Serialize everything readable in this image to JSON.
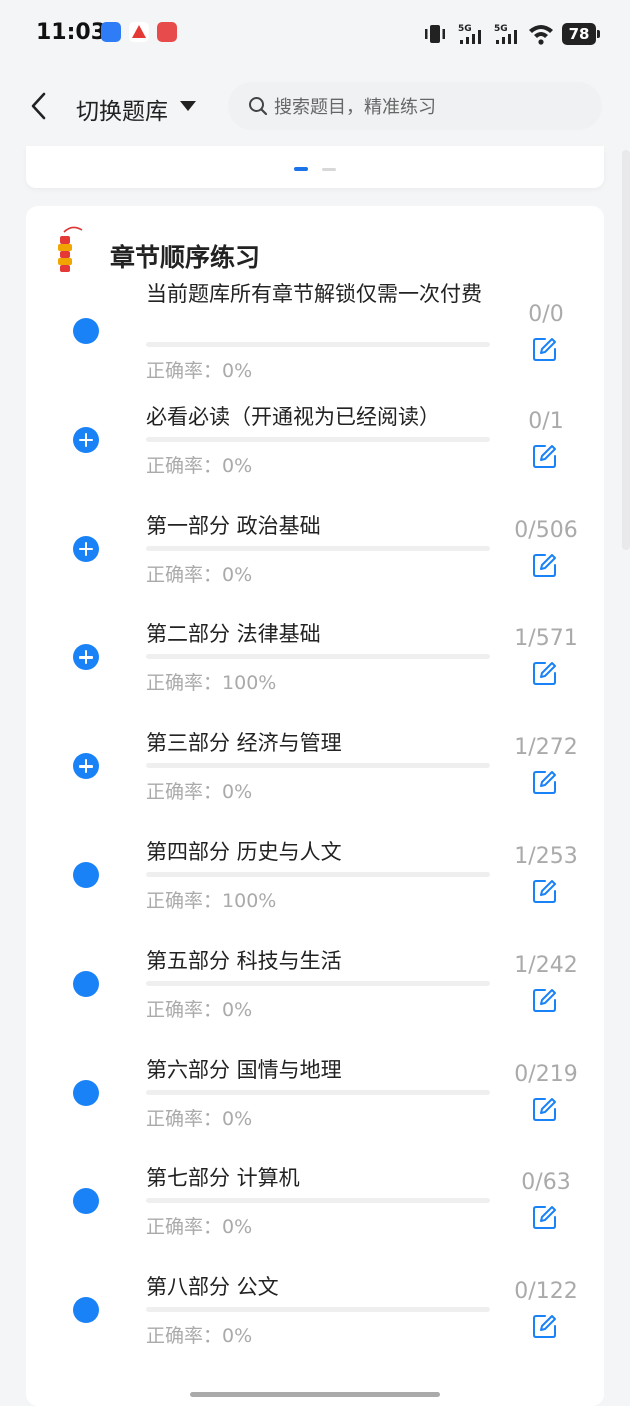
{
  "status_bar": {
    "time": "11:03",
    "battery": "78",
    "network": "5G",
    "icons": [
      "vibrate-icon",
      "signal-5g-icon",
      "signal-5g-icon",
      "wifi-icon",
      "battery-icon"
    ]
  },
  "header": {
    "title": "切换题库",
    "search_placeholder": "搜索题目，精准练习"
  },
  "section": {
    "title": "章节顺序练习",
    "accuracy_label": "正确率：",
    "chapters": [
      {
        "title": "当前题库所有章节解锁仅需一次付费",
        "accuracy": "0%",
        "count": "0/0",
        "bullet": "dot"
      },
      {
        "title": "必看必读（开通视为已经阅读）",
        "accuracy": "0%",
        "count": "0/1",
        "bullet": "plus"
      },
      {
        "title": "第一部分 政治基础",
        "accuracy": "0%",
        "count": "0/506",
        "bullet": "plus"
      },
      {
        "title": "第二部分 法律基础",
        "accuracy": "100%",
        "count": "1/571",
        "bullet": "plus"
      },
      {
        "title": "第三部分 经济与管理",
        "accuracy": "0%",
        "count": "1/272",
        "bullet": "plus"
      },
      {
        "title": "第四部分 历史与人文",
        "accuracy": "100%",
        "count": "1/253",
        "bullet": "dot"
      },
      {
        "title": "第五部分 科技与生活",
        "accuracy": "0%",
        "count": "1/242",
        "bullet": "dot"
      },
      {
        "title": "第六部分 国情与地理",
        "accuracy": "0%",
        "count": "0/219",
        "bullet": "dot"
      },
      {
        "title": "第七部分 计算机",
        "accuracy": "0%",
        "count": "0/63",
        "bullet": "dot"
      },
      {
        "title": "第八部分 公文",
        "accuracy": "0%",
        "count": "0/122",
        "bullet": "dot"
      }
    ]
  },
  "colors": {
    "accent": "#1a82f7",
    "muted_text": "#aaaaaa",
    "background": "#f4f5f7"
  }
}
